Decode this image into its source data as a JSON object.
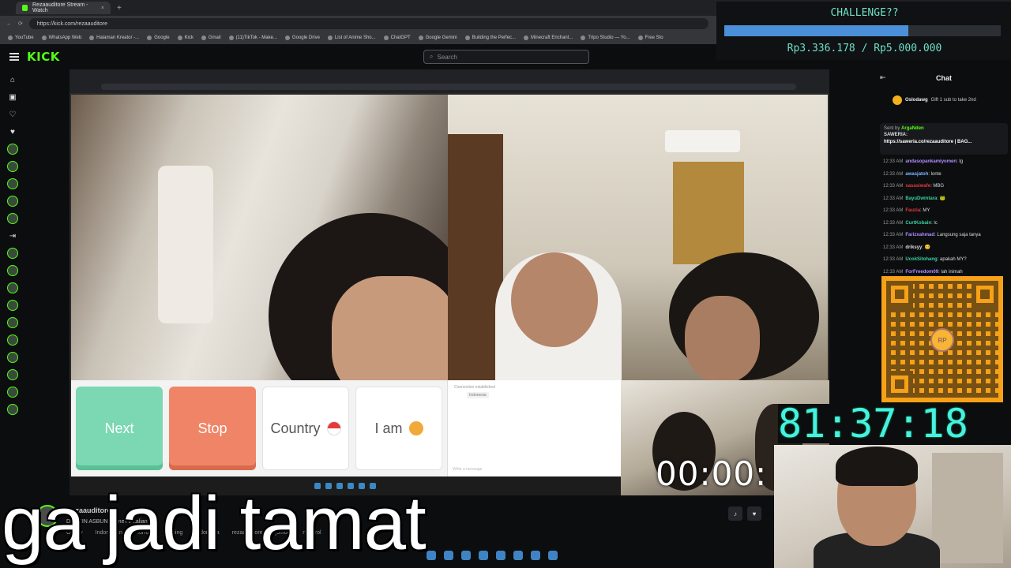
{
  "browser": {
    "tab_title": "Rezaauditore Stream - Watch",
    "tab_close": "×",
    "new_tab": "+",
    "url": "https://kick.com/rezaauditore",
    "bookmarks": [
      "YouTube",
      "WhatsApp Web",
      "Halaman Kreator -...",
      "Google",
      "Kick",
      "Gmail",
      "(11)TikTok - Make...",
      "Google Drive",
      "List of Anime Sho...",
      "ChatGPT",
      "Google Gemini",
      "Building the Perfec...",
      "Minecraft Enchant...",
      "Tripo Studio — Yo...",
      "Free Sto"
    ]
  },
  "kick": {
    "logo": "KICK",
    "search_placeholder": "Search"
  },
  "stream_video": {
    "buttons": {
      "next": "Next",
      "stop": "Stop",
      "country": "Country",
      "iam": "I am"
    },
    "chatbox_status": "Connection established",
    "chatbox_sub": "Indonesia",
    "chatbox_input": "Write a message",
    "sub_timer": "00:00:"
  },
  "channel": {
    "name": "Rezaauditore",
    "title": "DRACIN ASBUN? OmeTV kalian? | ...",
    "tags": [
      "Ometv",
      "Indonesian",
      "Horror",
      "yapping",
      "Indonesia",
      "rezaauditore",
      "jomok",
      "ngobrol"
    ]
  },
  "overlay_caption": "ga jadi tamat",
  "chat": {
    "header": "Chat",
    "gift_user": "Oslodawg",
    "gift_text": "Gift 1 sub to take 2nd",
    "pinned_by_label": "Sent by",
    "pinned_by_user": "ArgaNden",
    "pinned_title": "SAWERIA:",
    "pinned_link": "https://saweria.co/rezaauditore | BAG...",
    "messages": [
      {
        "time": "12:33 AM",
        "user": "andasopankamiyomen",
        "color": "#b48cff",
        "text": "lg"
      },
      {
        "time": "12:33 AM",
        "user": "awasjatoh",
        "color": "#7fb6ff",
        "text": "lonte"
      },
      {
        "time": "12:33 AM",
        "user": "sasasiwafe",
        "color": "#e23b3b",
        "text": "MBG"
      },
      {
        "time": "12:33 AM",
        "user": "BayuDwintara",
        "color": "#3bd1a0",
        "text": "🐸"
      },
      {
        "time": "12:33 AM",
        "user": "Fauzia",
        "color": "#e23b3b",
        "text": "MY"
      },
      {
        "time": "12:33 AM",
        "user": "CurtKobain",
        "color": "#3bd1a0",
        "text": "lc"
      },
      {
        "time": "12:33 AM",
        "user": "Farizxahmad",
        "color": "#b48cff",
        "text": "Langsung saja tanya"
      },
      {
        "time": "12:33 AM",
        "user": "driksyy",
        "color": "#dddddd",
        "text": "😊"
      },
      {
        "time": "12:33 AM",
        "user": "UcokSitohang",
        "color": "#3bd1a0",
        "text": "apakah MY?"
      },
      {
        "time": "12:33 AM",
        "user": "ForFreedom09",
        "color": "#b48cff",
        "text": "lah inimah"
      }
    ],
    "qr_label": "RP"
  },
  "challenge": {
    "title": "CHALLENGE??",
    "progress_text": "Rp3.336.178 / Rp5.000.000",
    "progress_fraction": 0.667
  },
  "big_timer": "81:37:18",
  "colors": {
    "kick_green": "#53fc18",
    "challenge_text": "#6fe0c8",
    "progress_fill": "#4a8fd8",
    "timer_cyan": "#46f0e6"
  }
}
